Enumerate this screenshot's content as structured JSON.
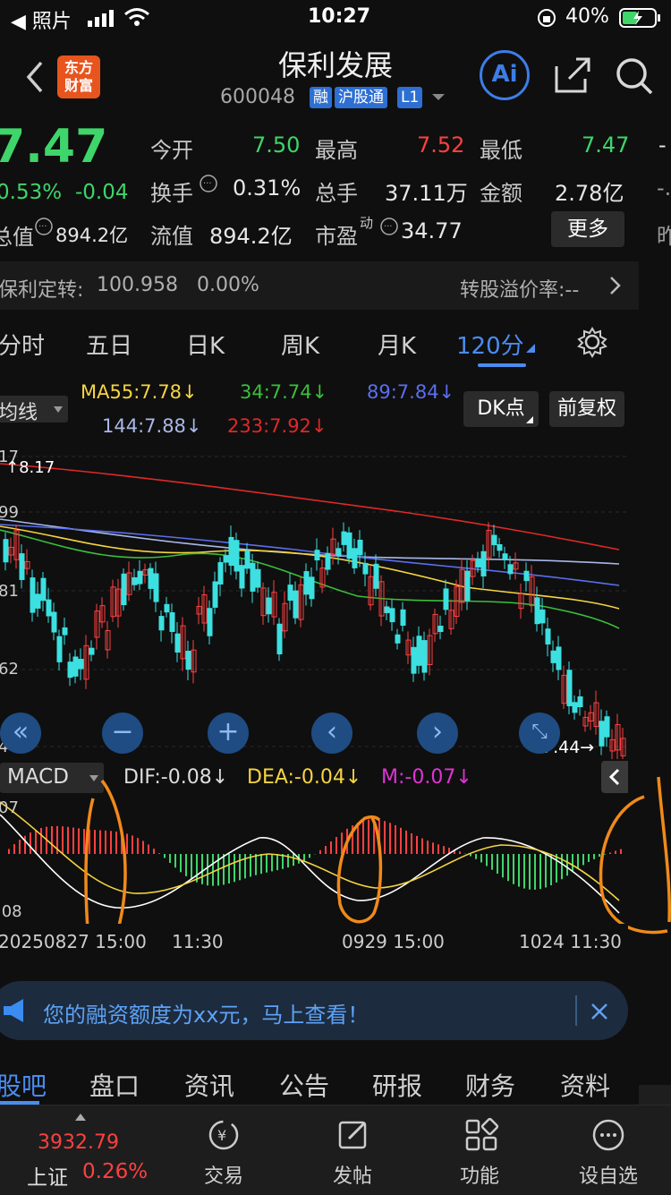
{
  "status_bar": {
    "back_app": "◀ 照片",
    "time": "10:27",
    "battery": "40%"
  },
  "header": {
    "title": "保利发展",
    "code": "600048",
    "tags": [
      "融",
      "沪股通",
      "L1"
    ],
    "logo": "东方\n财富",
    "ai_label": "Ai"
  },
  "quote": {
    "price": "7.47",
    "change_pct": "0.53%",
    "change": "-0.04",
    "mktcap_label": "总值",
    "mktcap": "894.2亿",
    "open_label": "今开",
    "open": "7.50",
    "high_label": "最高",
    "high": "7.52",
    "low_label": "最低",
    "low": "7.47",
    "turnover_label": "换手",
    "turnover": "0.31%",
    "volume_label": "总手",
    "volume": "37.11万",
    "amount_label": "金额",
    "amount": "2.78亿",
    "float_label": "流值",
    "float": "894.2亿",
    "pe_label": "市盈",
    "pe_sup": "动",
    "pe": "34.77",
    "more_label": "更多",
    "right_edge_top": "-",
    "right_edge_mid": "-.",
    "right_edge_bottom": "昨"
  },
  "conv_bond": {
    "name": "保利定转:",
    "price": "100.958",
    "pct": "0.00%",
    "premium": "转股溢价率:--"
  },
  "kline_tabs": [
    "分时",
    "五日",
    "日K",
    "周K",
    "月K",
    "120分"
  ],
  "ma_bar": {
    "selector": "均线",
    "ma55": "MA55:7.78↓",
    "ma34": "34:7.74↓",
    "ma89": "89:7.84↓",
    "ma144": "144:7.88↓",
    "ma233": "233:7.92↓",
    "dk_button": "DK点",
    "fuquan_button": "前复权"
  },
  "chart_axis": {
    "y_labels": [
      "17",
      "99",
      "81",
      "62",
      "44"
    ],
    "max_label": "8.17",
    "last_label": "7.44→"
  },
  "macd_bar": {
    "selector": "MACD",
    "dif": "DIF:-0.08↓",
    "dea": "DEA:-0.04↓",
    "m": "M:-0.07↓",
    "y_top": "07",
    "y_bottom": ".08"
  },
  "x_labels": [
    "20250827 15:00",
    "11:30",
    "0929 15:00",
    "1024 11:30"
  ],
  "banner": {
    "text": "您的融资额度为xx元，马上查看！"
  },
  "bottom_tabs": [
    "股吧",
    "盘口",
    "资讯",
    "公告",
    "研报",
    "财务",
    "资料"
  ],
  "nav": {
    "index_value": "3932.79",
    "index_name": "上证",
    "index_pct": "0.26%",
    "items": [
      "交易",
      "发帖",
      "功能",
      "设自选"
    ]
  },
  "colors": {
    "up": "#ff4040",
    "down": "#3ed56a",
    "accent": "#4a8cf0",
    "candle_down": "#3ce0e0"
  },
  "chart_data": {
    "type": "candlestick",
    "series": [
      {
        "name": "MA55",
        "values": []
      },
      {
        "name": "34",
        "values": []
      },
      {
        "name": "89",
        "values": []
      },
      {
        "name": "144",
        "values": []
      },
      {
        "name": "233",
        "values": []
      }
    ],
    "macd": {
      "dif": -0.08,
      "dea": -0.04,
      "m": -0.07
    },
    "last_price": 7.44,
    "max_price": 8.17
  }
}
